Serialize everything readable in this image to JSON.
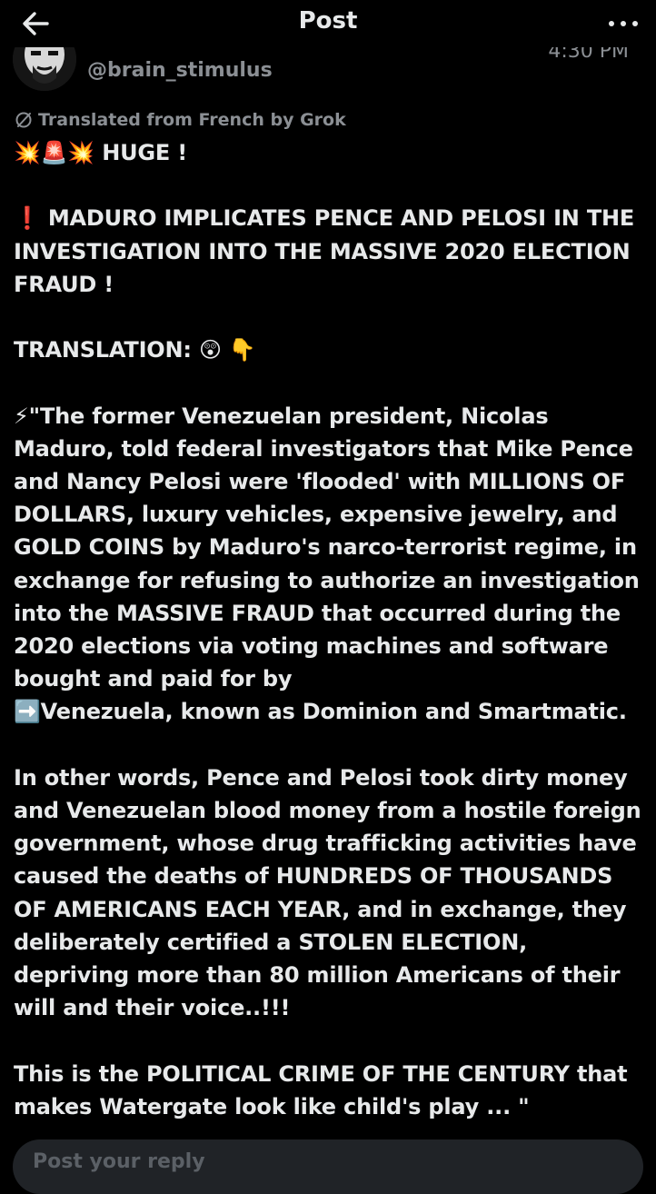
{
  "header": {
    "title": "Post",
    "back_icon": "arrow-left-icon",
    "more_icon": "more-horizontal-icon"
  },
  "author": {
    "handle": "@brain_stimulus",
    "timestamp": "4:30 PM"
  },
  "post": {
    "translated_note": "Translated from French by Grok",
    "text": "💥🚨💥 HUGE !\n\n❗ MADURO IMPLICATES PENCE AND PELOSI IN THE INVESTIGATION INTO THE MASSIVE 2020 ELECTION FRAUD !\n\nTRANSLATION: 😲 👇\n\n⚡\"The former Venezuelan president, Nicolas Maduro, told federal investigators that Mike Pence and Nancy Pelosi were 'flooded' with MILLIONS OF DOLLARS, luxury vehicles, expensive jewelry, and GOLD COINS by Maduro's narco-terrorist regime, in exchange for refusing to authorize an investigation into the MASSIVE FRAUD that occurred during the 2020 elections via voting machines and software bought and paid for by\n➡️Venezuela, known as Dominion and Smartmatic.\n\nIn other words, Pence and Pelosi took dirty money and Venezuelan blood money from a hostile foreign government, whose drug trafficking activities have caused the deaths of HUNDREDS OF THOUSANDS OF AMERICANS EACH YEAR, and in exchange, they deliberately certified a STOLEN ELECTION, depriving more than 80 million Americans of their will and their voice..!!!\n\nThis is the POLITICAL CRIME OF THE CENTURY that makes Watergate look like child's play ... \""
  },
  "reply": {
    "placeholder": "Post your reply"
  },
  "colors": {
    "background": "#000000",
    "text": "#e7e9ea",
    "muted": "#8b8f94",
    "reply_bg": "#202327"
  }
}
